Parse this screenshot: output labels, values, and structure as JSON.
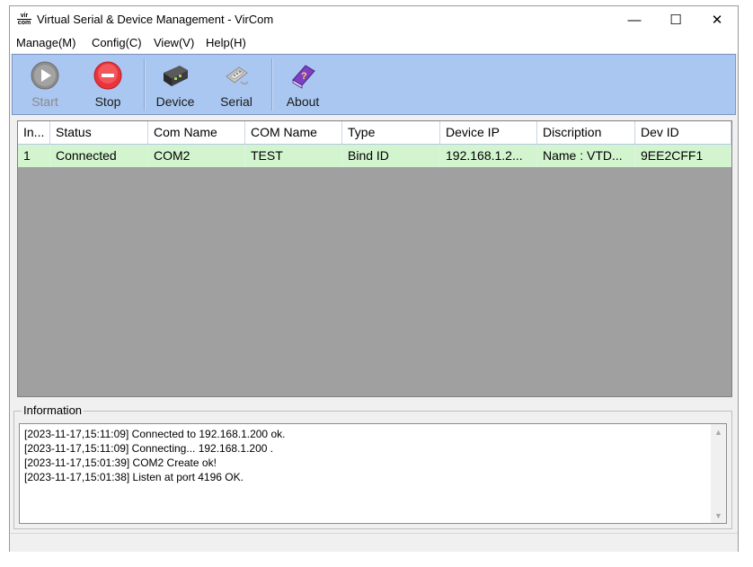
{
  "window": {
    "app_icon_text": "vir\ncom",
    "title": "Virtual Serial & Device Management - VirCom",
    "controls": {
      "minimize": "—",
      "maximize": "☐",
      "close": "✕"
    }
  },
  "menu": [
    "Manage(M)",
    "Config(C)",
    "View(V)",
    "Help(H)"
  ],
  "toolbar": {
    "start_label": "Start",
    "stop_label": "Stop",
    "device_label": "Device",
    "serial_label": "Serial",
    "about_label": "About",
    "start_enabled": false,
    "colors": {
      "stop_red": "#e8343a",
      "play_gray": "#8c8c8c",
      "about_purple": "#7d3fc4"
    }
  },
  "table": {
    "columns": [
      "In...",
      "Status",
      "Com Name",
      "COM Name",
      "Type",
      "Device IP",
      "Discription",
      "Dev ID"
    ],
    "rows": [
      [
        "1",
        "Connected",
        "COM2",
        "TEST",
        "Bind ID",
        "192.168.1.2...",
        "Name : VTD...",
        "9EE2CFF1"
      ]
    ],
    "row_color": "#d2f5cf"
  },
  "information": {
    "title": "Information",
    "log": [
      "[2023-11-17,15:11:09] Connected to 192.168.1.200 ok.",
      "[2023-11-17,15:11:09] Connecting... 192.168.1.200 .",
      "[2023-11-17,15:01:39] COM2 Create ok!",
      "[2023-11-17,15:01:38] Listen at port 4196 OK."
    ]
  }
}
